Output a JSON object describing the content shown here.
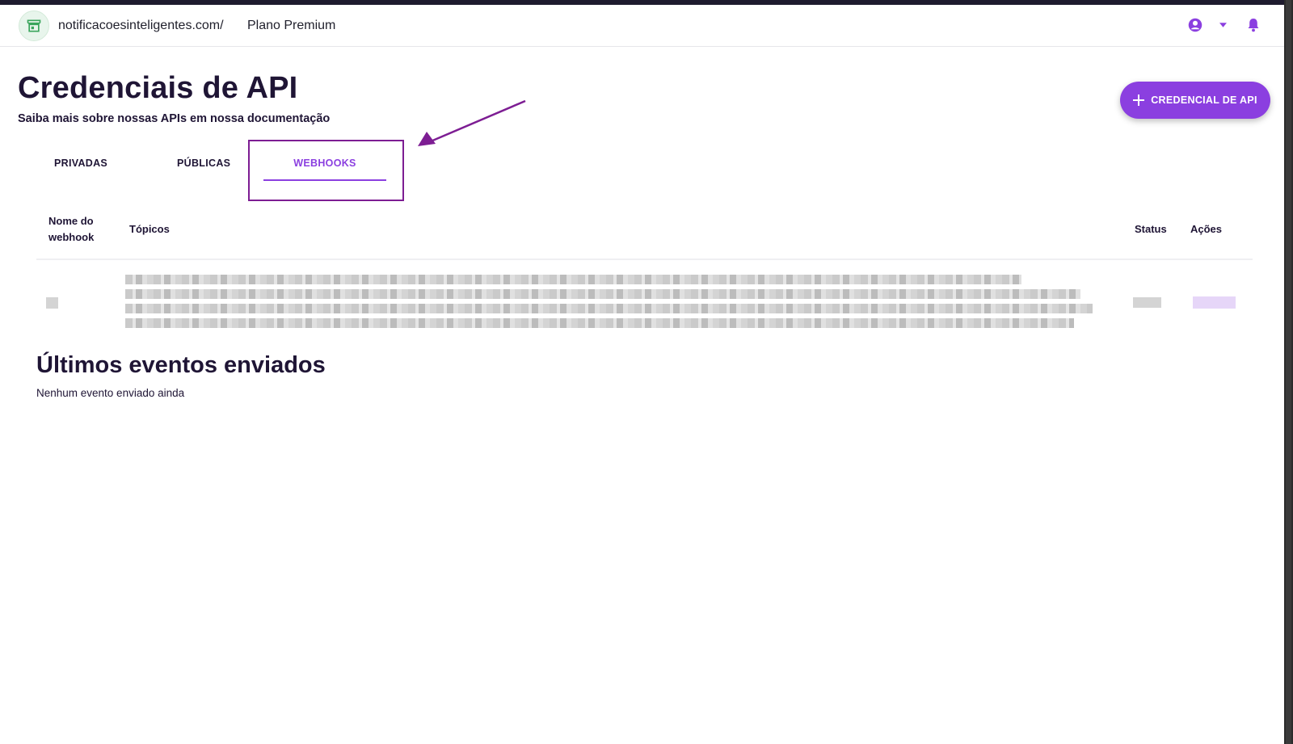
{
  "topbar": {
    "site": "notificacoesinteligentes.com/",
    "plan": "Plano Premium",
    "icons": {
      "store": "store-icon",
      "account": "account-circle-icon",
      "dropdown": "caret-down-icon",
      "notifications": "bell-icon"
    }
  },
  "page": {
    "title": "Credenciais de API",
    "subtitle": "Saiba mais sobre nossas APIs em nossa documentação",
    "cta_label": "CREDENCIAL DE API",
    "cta_icon": "plus-icon"
  },
  "tabs": {
    "items": [
      {
        "label": "PRIVADAS"
      },
      {
        "label": "PÚBLICAS"
      },
      {
        "label": "WEBHOOKS"
      }
    ],
    "active": "WEBHOOKS"
  },
  "table": {
    "headers": {
      "name": "Nome do webhook",
      "topics": "Tópicos",
      "status": "Status",
      "actions": "Ações"
    }
  },
  "events": {
    "title": "Últimos eventos enviados",
    "empty": "Nenhum evento enviado ainda"
  },
  "colors": {
    "accent": "#8b3fe0",
    "annotation": "#7d1d93",
    "text": "#1f1535",
    "store_icon": "#3aa55c"
  }
}
